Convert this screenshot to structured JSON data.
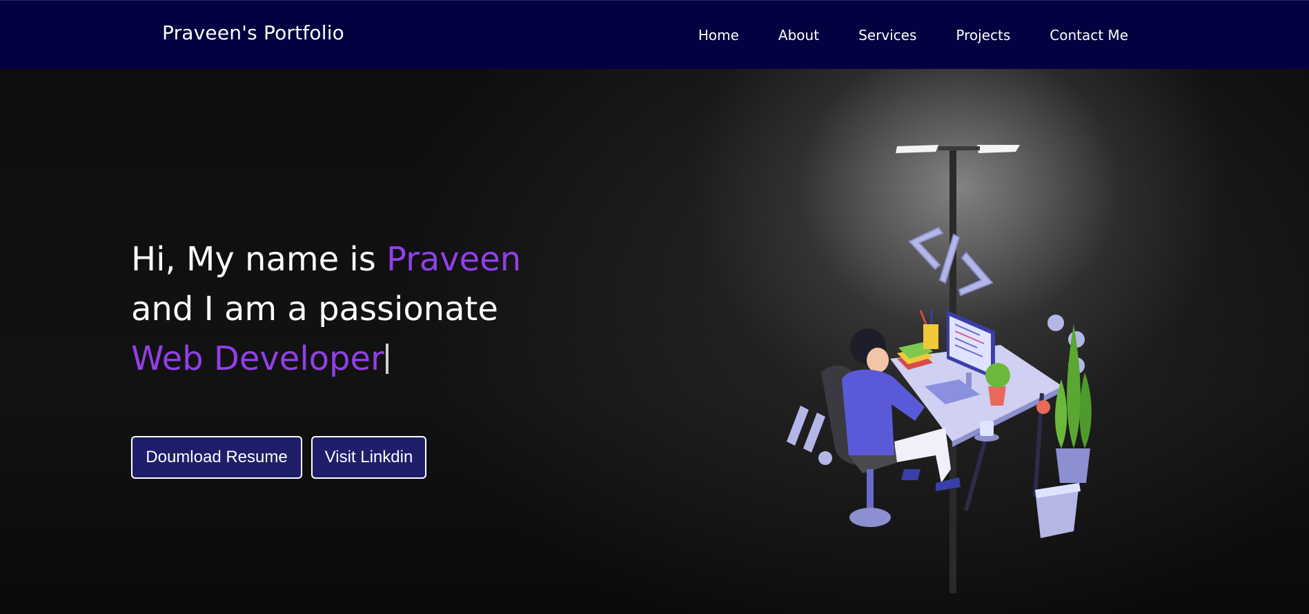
{
  "nav": {
    "brand": "Praveen's Portfolio",
    "links": [
      "Home",
      "About",
      "Services",
      "Projects",
      "Contact Me"
    ]
  },
  "hero": {
    "line1_prefix": "Hi, My name is ",
    "name": "Praveen",
    "line2": "and I am a passionate",
    "role": "Web Developer",
    "buttons": {
      "resume": "Doumload Resume",
      "linkedin": "Visit Linkdin"
    }
  },
  "colors": {
    "navbar": "#020240",
    "accent": "#9140e8",
    "button": "#1e1e6a"
  },
  "icons": [
    "street-lamp",
    "developer-desk-illustration",
    "code-tag-icon"
  ]
}
